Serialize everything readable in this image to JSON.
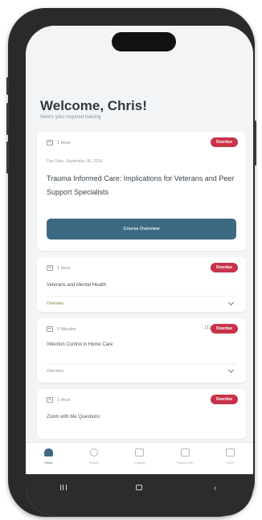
{
  "header": {
    "welcome": "Welcome, Chris!",
    "subtitle": "Here's your required training"
  },
  "cards": [
    {
      "meta": "1 Hour",
      "badge": "Overdue",
      "date": "Due Date: September 30, 2024",
      "title": "Trauma Informed Care: Implications for Veterans and Peer Support Specialists",
      "button": "Course Overview"
    },
    {
      "meta": "1 Hour",
      "badge": "Overdue",
      "title": "Veterans and Mental Health",
      "expander": "Overview"
    },
    {
      "meta": "0 Minutes",
      "count": "(1)",
      "badge": "Overdue",
      "title": "Infection Control in Home Care",
      "expander": "Overview"
    },
    {
      "meta": "1 Hour",
      "badge": "Overdue",
      "title": "Zoom with Me Questions"
    }
  ],
  "tabs": [
    {
      "label": "Home",
      "icon": "home-icon"
    },
    {
      "label": "Search",
      "icon": "search-icon"
    },
    {
      "label": "Catalog",
      "icon": "catalog-icon"
    },
    {
      "label": "Documents",
      "icon": "documents-icon"
    },
    {
      "label": "More",
      "icon": "more-icon"
    }
  ],
  "colors": {
    "accent": "#3d6a82",
    "badge": "#c8334a",
    "background": "#f2f4f6"
  }
}
